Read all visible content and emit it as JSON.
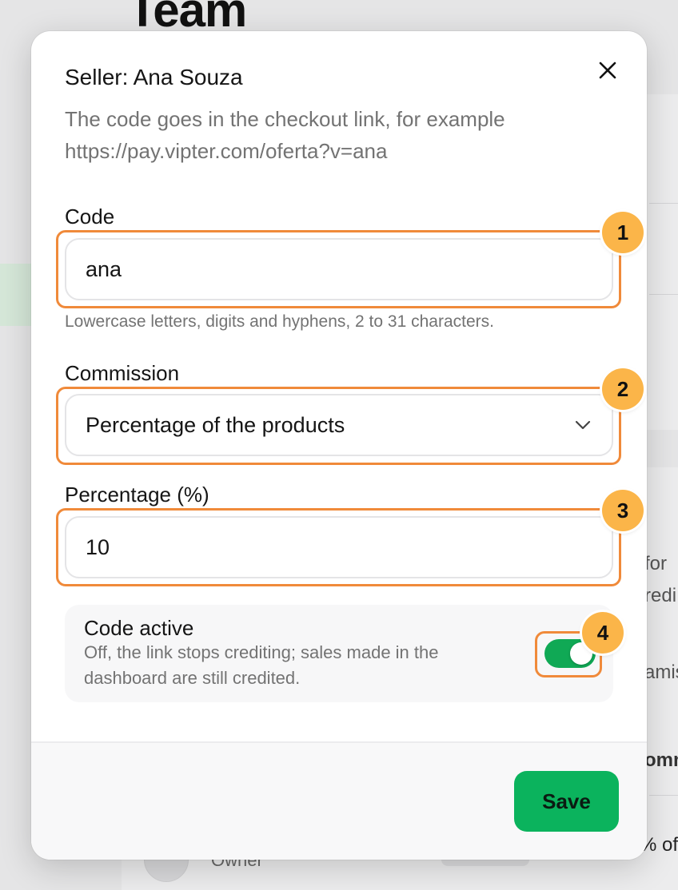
{
  "background": {
    "page_title": "Team",
    "fragments": [
      "for",
      "redi",
      "amis",
      "omm",
      "% of",
      "Owner"
    ]
  },
  "modal": {
    "title": "Seller: Ana Souza",
    "description_line1": "The code goes in the checkout link, for example",
    "description_line2": "https://pay.vipter.com/oferta?v=ana",
    "close_icon": "close-icon",
    "code": {
      "label": "Code",
      "value": "ana",
      "hint": "Lowercase letters, digits and hyphens, 2 to 31 characters."
    },
    "commission": {
      "label": "Commission",
      "selected": "Percentage of the products"
    },
    "percentage": {
      "label": "Percentage (%)",
      "value": "10"
    },
    "active": {
      "title": "Code active",
      "description": "Off, the link stops crediting; sales made in the dashboard are still credited.",
      "on": true
    },
    "save_label": "Save"
  },
  "annotations": [
    "1",
    "2",
    "3",
    "4"
  ],
  "colors": {
    "accent_green": "#0bb35d",
    "toggle_green": "#10a955",
    "annotation_orange": "#f08a3a",
    "badge_fill": "#fbb549"
  }
}
